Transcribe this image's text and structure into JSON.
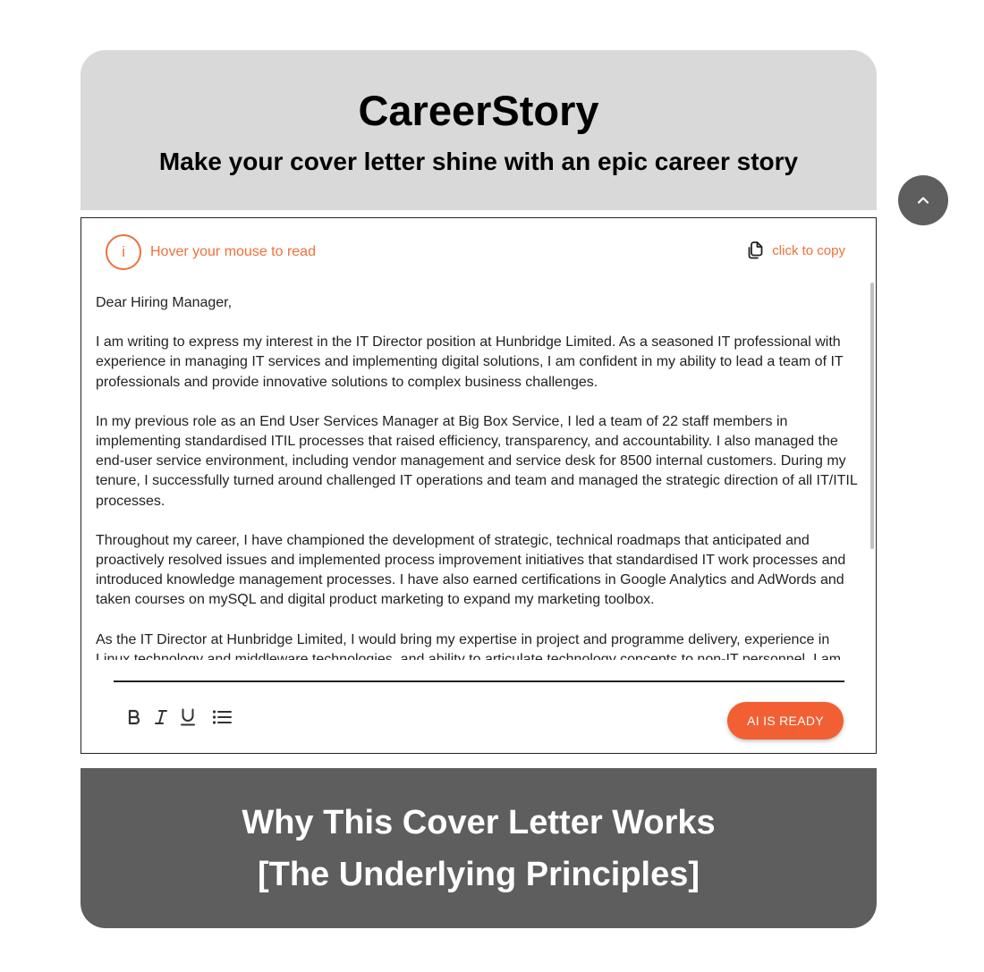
{
  "header": {
    "title": "CareerStory",
    "subtitle": "Make your cover letter shine with an epic career story"
  },
  "scroll_top": {
    "icon": "chevron-up-icon"
  },
  "editor": {
    "info_icon_glyph": "i",
    "info_text": "Hover your mouse to read",
    "copy_label": "click to copy",
    "paragraphs": [
      "Dear Hiring Manager,",
      "I am writing to express my interest in the IT Director position at Hunbridge Limited. As a seasoned IT professional with experience in managing IT services and implementing digital solutions, I am confident in my ability to lead a team of IT professionals and provide innovative solutions to complex business challenges.",
      "In my previous role as an End User Services Manager at Big Box Service, I led a team of 22 staff members in implementing standardised ITIL processes that raised efficiency, transparency, and accountability. I also managed the end-user service environment, including vendor management and service desk for 8500 internal customers. During my tenure, I successfully turned around challenged IT operations and team and managed the strategic direction of all IT/ITIL processes.",
      "Throughout my career, I have championed the development of strategic, technical roadmaps that anticipated and proactively resolved issues and implemented process improvement initiatives that standardised IT work processes and introduced knowledge management processes. I have also earned certifications in Google Analytics and AdWords and taken courses on mySQL and digital product marketing to expand my marketing toolbox.",
      "As the IT Director at Hunbridge Limited, I would bring my expertise in project and programme delivery, experience in Linux technology and middleware technologies, and ability to articulate technology concepts to non-IT personnel. I am confident in my ability to manage the end-to-end delivery of IT services, technology and digital provision across the business, as well as"
    ],
    "toolbar": [
      "bold-icon",
      "italic-icon",
      "underline-icon",
      "bullet-list-icon"
    ],
    "ai_button_label": "AI IS READY"
  },
  "footer": {
    "line1": "Why This Cover Letter Works",
    "line2": "[The Underlying Principles]"
  },
  "colors": {
    "accent": "#f25f33",
    "header_bg": "#d9d9d9",
    "footer_bg": "#5e5e5e"
  }
}
